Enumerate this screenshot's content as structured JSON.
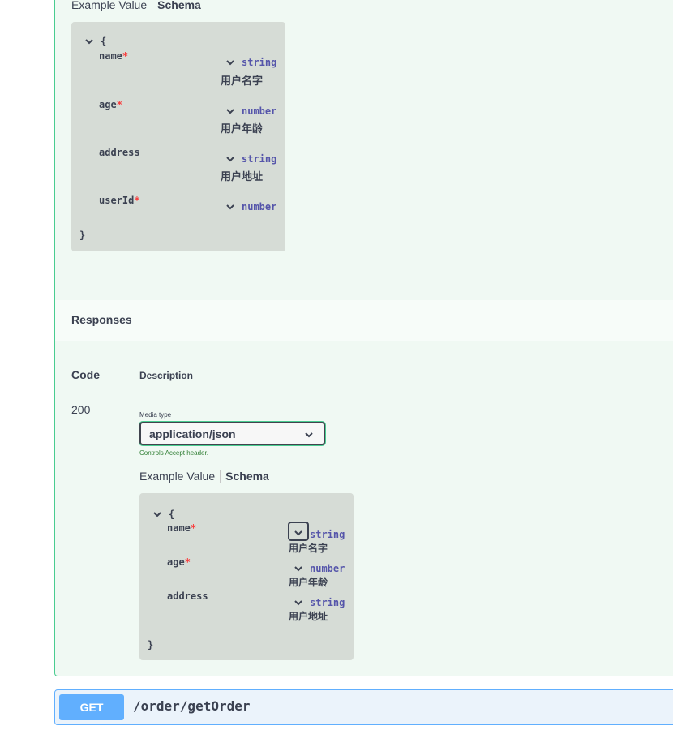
{
  "request_body": {
    "tabs": [
      "Example Value",
      "Schema"
    ],
    "open_brace": "{",
    "close_brace": "}",
    "properties": [
      {
        "name": "name",
        "required": true,
        "type": "string",
        "description": "用户名字"
      },
      {
        "name": "age",
        "required": true,
        "type": "number",
        "description": "用户年龄"
      },
      {
        "name": "address",
        "required": false,
        "type": "string",
        "description": "用户地址"
      },
      {
        "name": "userId",
        "required": true,
        "type": "number",
        "description": ""
      }
    ]
  },
  "responses": {
    "title": "Responses",
    "col_code": "Code",
    "col_description": "Description",
    "rows": [
      {
        "code": "200",
        "media_type_label": "Media type",
        "media_type_value": "application/json",
        "controls_note": "Controls Accept header.",
        "tabs": [
          "Example Value",
          "Schema"
        ],
        "open_brace": "{",
        "close_brace": "}",
        "properties": [
          {
            "name": "name",
            "required": true,
            "type": "string",
            "description": "用户名字"
          },
          {
            "name": "age",
            "required": true,
            "type": "number",
            "description": "用户年龄"
          },
          {
            "name": "address",
            "required": false,
            "type": "string",
            "description": "用户地址"
          }
        ]
      }
    ]
  },
  "required_mark": "*",
  "next_operation": {
    "method": "GET",
    "path": "/order/getOrder"
  },
  "icons": {
    "toggle": "chevron-down-icon"
  },
  "colors": {
    "get": "#61affe",
    "post_border": "#49cc90",
    "required": "#f93e3e",
    "type": "#55aa"
  }
}
